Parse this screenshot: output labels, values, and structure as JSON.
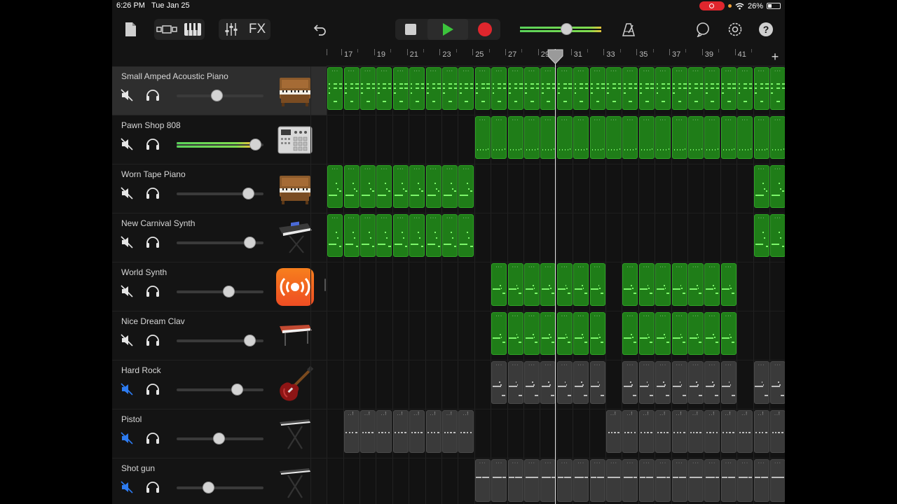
{
  "status_bar": {
    "time": "6:26 PM",
    "date": "Tue Jan 25",
    "battery": "26%"
  },
  "ruler": {
    "bar_labels": [
      "17",
      "19",
      "21",
      "23",
      "25",
      "27",
      "29",
      "31",
      "33",
      "35",
      "37",
      "39",
      "41"
    ]
  },
  "transport": {
    "playing": true
  },
  "tracks": [
    {
      "name": "Small Amped Acoustic Piano",
      "volume": 0.46,
      "muted": false,
      "instrument_icon": "upright-piano-icon",
      "selected": true
    },
    {
      "name": "Pawn Shop 808",
      "volume": 0.9,
      "muted": false,
      "instrument_icon": "drum-machine-icon",
      "selected": false,
      "meter": true
    },
    {
      "name": "Worn Tape Piano",
      "volume": 0.82,
      "muted": false,
      "instrument_icon": "upright-piano-icon",
      "selected": false
    },
    {
      "name": "New Carnival Synth",
      "volume": 0.84,
      "muted": false,
      "instrument_icon": "synth-keyboard-icon",
      "selected": false
    },
    {
      "name": "World Synth",
      "volume": 0.6,
      "muted": false,
      "instrument_icon": "orange-broadcast-icon",
      "selected": false
    },
    {
      "name": "Nice Dream Clav",
      "volume": 0.84,
      "muted": false,
      "instrument_icon": "red-keyboard-icon",
      "selected": false
    },
    {
      "name": "Hard Rock",
      "volume": 0.69,
      "muted": true,
      "instrument_icon": "electric-guitar-icon",
      "selected": false
    },
    {
      "name": "Pistol",
      "volume": 0.48,
      "muted": true,
      "instrument_icon": "keyboard-stand-icon",
      "selected": false
    },
    {
      "name": "Shot gun",
      "volume": 0.36,
      "muted": true,
      "instrument_icon": "keyboard-stand-icon",
      "selected": false
    }
  ],
  "colors": {
    "region_green": "#1f7d18",
    "region_gray": "#3a3a3a",
    "record": "#e0262d",
    "play": "#3cc43c",
    "mute_active": "#2d7bf0"
  }
}
